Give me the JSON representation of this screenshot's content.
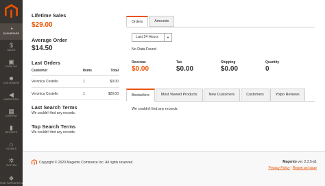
{
  "sidebar": {
    "items": [
      {
        "label": "DASHBOARD",
        "icon": "dashboard-icon",
        "glyph": "◔"
      },
      {
        "label": "SALES",
        "icon": "dollar-icon",
        "glyph": "$"
      },
      {
        "label": "CATALOG",
        "icon": "cube-icon",
        "glyph": "▣"
      },
      {
        "label": "CUSTOMERS",
        "icon": "person-icon",
        "glyph": "☻"
      },
      {
        "label": "MARKETING",
        "icon": "megaphone-icon",
        "glyph": "◀"
      },
      {
        "label": "CONTENT",
        "icon": "content-icon",
        "glyph": "▦"
      },
      {
        "label": "REPORTS",
        "icon": "bar-chart-icon",
        "glyph": "▮"
      },
      {
        "label": "STORES",
        "icon": "store-icon",
        "glyph": "⌂"
      },
      {
        "label": "SYSTEM",
        "icon": "gear-icon",
        "glyph": "✲"
      },
      {
        "label": "FIND PARTNERS & EXTENSIONS",
        "icon": "puzzle-icon",
        "glyph": "❖"
      }
    ]
  },
  "lifetime_sales": {
    "label": "Lifetime Sales",
    "value": "$29.00"
  },
  "average_order": {
    "label": "Average Order",
    "value": "$14.50"
  },
  "last_orders": {
    "title": "Last Orders",
    "columns": [
      "Customer",
      "Items",
      "Total"
    ],
    "rows": [
      [
        "Veronica Costello",
        "1",
        "$0.00"
      ],
      [
        "Veronica Costello",
        "1",
        "$29.00"
      ]
    ]
  },
  "last_search_terms": {
    "title": "Last Search Terms",
    "empty": "We couldn't find any records."
  },
  "top_search_terms": {
    "title": "Top Search Terms",
    "empty": "We couldn't find any records."
  },
  "chart_tabs": [
    "Orders",
    "Amounts"
  ],
  "period_select": {
    "value": "Last 24 Hours",
    "arrow": "▼"
  },
  "no_data": "No Data Found",
  "metrics": [
    {
      "label": "Revenue",
      "value": "$0.00",
      "color": "#eb5202"
    },
    {
      "label": "Tax",
      "value": "$0.00",
      "color": "#303030"
    },
    {
      "label": "Shipping",
      "value": "$0.00",
      "color": "#303030"
    },
    {
      "label": "Quantity",
      "value": "0",
      "color": "#303030"
    }
  ],
  "grid_tabs": [
    "Bestsellers",
    "Most Viewed Products",
    "New Customers",
    "Customers",
    "Yotpo Reviews"
  ],
  "grid_empty": "We couldn't find any records.",
  "footer": {
    "copyright": "Copyright © 2020 Magento Commerce Inc. All rights reserved.",
    "brand": "Magento",
    "version": " ver. 2.3.5-p1",
    "privacy": "Privacy Policy",
    "separator": "|",
    "report": "Report an Issue"
  },
  "colors": {
    "accent": "#eb5202",
    "sidebar": "#373330"
  }
}
